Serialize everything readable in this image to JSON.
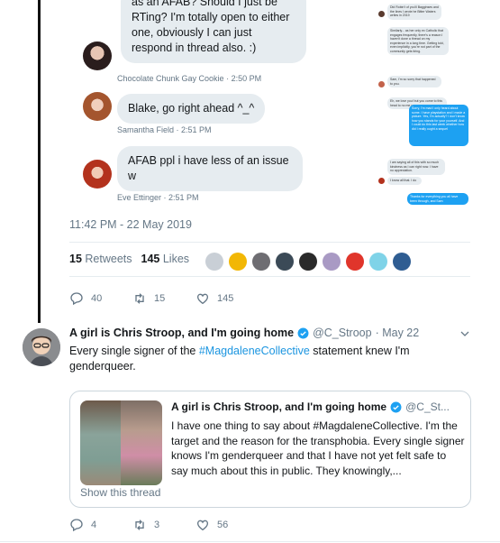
{
  "dm": {
    "messages": [
      {
        "text_lines": [
          "as an AFAB? Should I just be",
          "RTing? I'm totally open to either",
          "one, obviously I can just",
          "respond in thread also. :)"
        ],
        "meta": "Chocolate Chunk Gay Cookie · 2:50 PM"
      },
      {
        "text_lines": [
          "Blake, go right ahead ^_^"
        ],
        "meta": "Samantha Field · 2:51 PM"
      },
      {
        "text_lines": [
          "AFAB ppl i have less of an issue",
          "w"
        ],
        "meta": "Eve Ettinger · 2:51 PM"
      }
    ],
    "right_messages": [
      "Did Robin't of you'll Bagginses and the lines I wrote he Bitter Waters writes in 2019",
      "Similarly... as her only ex Catholic that engages frequently, there's a reason I haven't done a thread on my experience in a long time. Getting told, even implicitly, you're not part of the community gets tiring.",
      "Sam, I'm so sorry that happened to you.",
      "Eh, we love you! but you come to this head to no me your",
      "Sorry, I'm mad I only heard about some. I have playstation and I made a picture. Yes, I'm actually? I don't know how you stands for your yourself. And I could do this last week whether how did I really ought a sequel",
      "I am saying all of this with so much kindness as I can right now. I have no appreciation.",
      "I know all that. I do",
      "Thanks for everything you all have been through, and Sam"
    ]
  },
  "tweet1": {
    "timestamp": "11:42 PM - 22 May 2019",
    "retweets_count": "15",
    "retweets_label": "Retweets",
    "likes_count": "145",
    "likes_label": "Likes",
    "reply_count": "40",
    "retweet_count_action": "15",
    "like_count_action": "145"
  },
  "tweet2": {
    "name": "A girl is Chris Stroop, and I'm going home",
    "handle": "@C_Stroop",
    "date": "· May 22",
    "body_before": "Every single signer of the ",
    "hashtag": "#MagdaleneCollective",
    "body_after": " statement knew I'm genderqueer.",
    "reply_count": "4",
    "retweet_count": "3",
    "like_count": "56"
  },
  "quote": {
    "name": "A girl is Chris Stroop, and I'm going home",
    "handle": "@C_St...",
    "text": "I have one thing to say about #MagdaleneCollective. I'm the target and the reason for the transphobia. Every single signer knows I'm genderqueer and that I have not yet felt safe to say much about this in public. They knowingly,...",
    "show_thread": "Show this thread"
  },
  "colors": {
    "accent": "#1da1f2",
    "muted": "#657786",
    "bubble": "#e6ecf0",
    "verified": "#1da1f2"
  }
}
